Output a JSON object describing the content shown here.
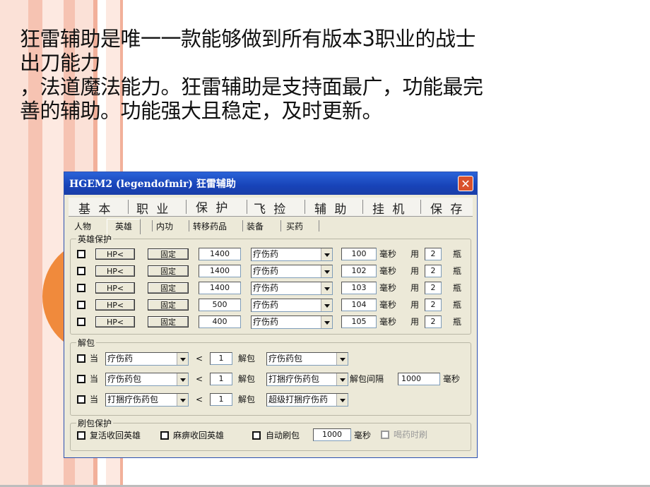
{
  "headline": {
    "line1": "狂雷辅助是唯一一款能够做到所有版本3职业的战士",
    "line2": "出刀能力",
    "line3": "，法道魔法能力。狂雷辅助是支持面最广，功能最完",
    "line4": "善的辅助。功能强大且稳定，及时更新。"
  },
  "colors": {
    "title_bar": "#1743b8",
    "close": "#d9512c",
    "dialog_bg": "#ece9d8",
    "stripe_pink": "#f6c3b2",
    "accent_orange": "#f08a3c"
  },
  "dialog": {
    "title": "HGEM2 (legendofmir) 狂雷辅助",
    "close_icon": "close-icon",
    "main_tabs": [
      "基 本",
      "职 业",
      "保 护",
      "飞 捡",
      "辅 助",
      "挂 机",
      "保 存"
    ],
    "active_main_tab": "保 护",
    "sub_tabs": [
      "人物",
      "英雄",
      "内功",
      "转移药品",
      "装备",
      "买药"
    ],
    "active_sub_tab": "英雄",
    "hero_protect": {
      "legend": "英雄保护",
      "rows": [
        {
          "type": "HP<",
          "button": "固定",
          "threshold": "1400",
          "item": "疗伤药",
          "interval": "100",
          "unit": "毫秒",
          "use_label": "用",
          "count": "2",
          "count_unit": "瓶"
        },
        {
          "type": "HP<",
          "button": "固定",
          "threshold": "1400",
          "item": "疗伤药",
          "interval": "102",
          "unit": "毫秒",
          "use_label": "用",
          "count": "2",
          "count_unit": "瓶"
        },
        {
          "type": "HP<",
          "button": "固定",
          "threshold": "1400",
          "item": "疗伤药",
          "interval": "103",
          "unit": "毫秒",
          "use_label": "用",
          "count": "2",
          "count_unit": "瓶"
        },
        {
          "type": "HP<",
          "button": "固定",
          "threshold": "500",
          "item": "疗伤药",
          "interval": "104",
          "unit": "毫秒",
          "use_label": "用",
          "count": "2",
          "count_unit": "瓶"
        },
        {
          "type": "HP<",
          "button": "固定",
          "threshold": "400",
          "item": "疗伤药",
          "interval": "105",
          "unit": "毫秒",
          "use_label": "用",
          "count": "2",
          "count_unit": "瓶"
        }
      ]
    },
    "unpack": {
      "legend": "解包",
      "rows": [
        {
          "when": "当",
          "item": "疗伤药",
          "lt": "<",
          "count": "1",
          "action": "解包",
          "target": "疗伤药包"
        },
        {
          "when": "当",
          "item": "疗伤药包",
          "lt": "<",
          "count": "1",
          "action": "解包",
          "target": "打捆疗伤药包"
        },
        {
          "when": "当",
          "item": "打捆疗伤药包",
          "lt": "<",
          "count": "1",
          "action": "解包",
          "target": "超级打捆疗伤药"
        }
      ],
      "interval_label": "解包间隔",
      "interval_value": "1000",
      "interval_unit": "毫秒"
    },
    "refresh": {
      "legend": "刷包保护",
      "revive_hero": "复活收回英雄",
      "paralyze_hero": "麻痹收回英雄",
      "auto_refresh": "自动刷包",
      "auto_value": "1000",
      "auto_unit": "毫秒",
      "drink_refresh": "喝药时刷"
    }
  }
}
